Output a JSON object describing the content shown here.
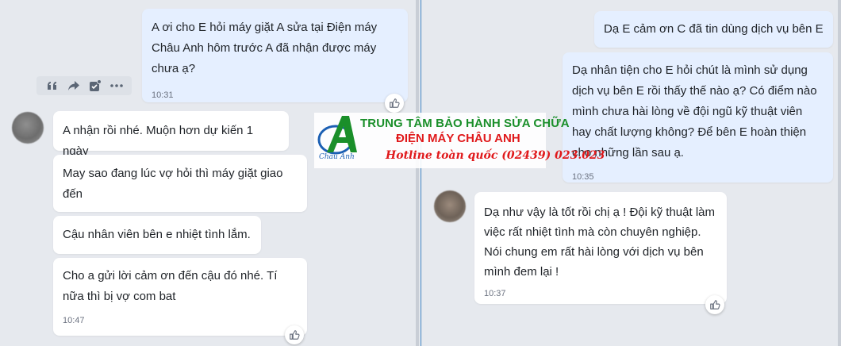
{
  "left_chat": {
    "outgoing": {
      "text": "A ơi cho E hỏi máy giặt A sửa tại Điện máy Châu Anh hôm trước A đã nhận được máy chưa ạ?",
      "time": "10:31"
    },
    "incoming": [
      {
        "text": "A nhận rồi nhé. Muộn hơn dự kiến 1 ngày"
      },
      {
        "text": "May sao đang lúc vợ hỏi thì máy giặt giao đến"
      },
      {
        "text": "Cậu nhân viên bên e nhiệt tình lắm."
      },
      {
        "text": "Cho a gửi lời cảm ơn đến cậu đó nhé. Tí nữa thì bị vợ com bat",
        "time": "10:47"
      }
    ],
    "message_actions": [
      "quote-icon",
      "forward-icon",
      "task-icon",
      "more-icon"
    ]
  },
  "right_chat": {
    "outgoing": [
      {
        "text": "Dạ E cảm ơn C đã tin dùng dịch vụ bên E"
      },
      {
        "text": "Dạ nhân tiện cho E hỏi chút là mình sử dụng dịch vụ bên E rồi thấy thế nào ạ? Có điểm nào mình chưa hài lòng về đội ngũ kỹ thuật viên hay chất lượng không? Để bên E hoàn thiện cho những lần sau ạ.",
        "time": "10:35"
      }
    ],
    "incoming": {
      "text": "Dạ như vậy là tốt rồi chị ạ ! Đội kỹ thuật làm việc rất nhiệt tình mà còn chuyên nghiệp. Nói chung em rất hài lòng với dịch vụ bên mình đem lại  !",
      "time": "10:37"
    }
  },
  "watermark": {
    "logo_letter": "A",
    "brand": "Châu Anh",
    "line1": "TRUNG TÂM BẢO HÀNH SỬA CHỮA",
    "line2": "ĐIỆN MÁY CHÂU ANH",
    "line3": "Hotline toàn quốc (02439) 023.023"
  },
  "colors": {
    "background": "#e6e9ee",
    "outgoing_bubble": "#e5efff",
    "incoming_bubble": "#ffffff",
    "watermark_green": "#1a8f2a",
    "watermark_red": "#e0191b",
    "watermark_blue": "#1b5fb3"
  }
}
